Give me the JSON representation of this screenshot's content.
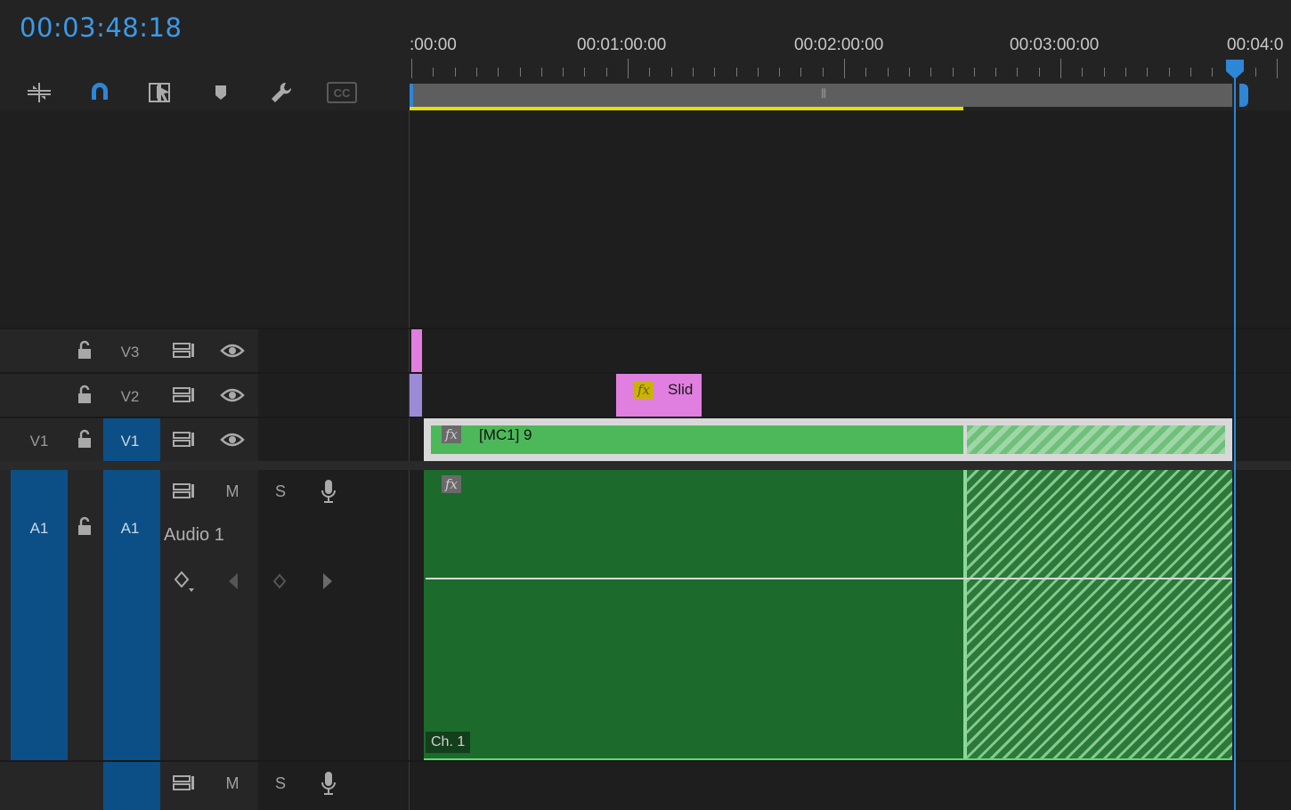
{
  "timecode": "00:03:48:18",
  "ruler": {
    "labels": [
      ":00:00",
      "00:01:00:00",
      "00:02:00:00",
      "00:03:00:00",
      "00:04:0"
    ]
  },
  "tools": [
    {
      "icon": "insert-edit-icon"
    },
    {
      "icon": "snap-magnet-icon"
    },
    {
      "icon": "linked-selection-icon"
    },
    {
      "icon": "add-marker-icon"
    },
    {
      "icon": "settings-wrench-icon"
    },
    {
      "icon": "closed-captions-icon",
      "label": "CC"
    }
  ],
  "tracks": {
    "v3": {
      "label": "V3"
    },
    "v2": {
      "label": "V2"
    },
    "v1": {
      "source": "V1",
      "label": "V1"
    },
    "a1": {
      "source": "A1",
      "label": "A1",
      "name": "Audio 1",
      "mute": "M",
      "solo": "S"
    },
    "a2": {
      "mute": "M",
      "solo": "S"
    }
  },
  "clips": {
    "v2": {
      "fx": "fx",
      "title": "Slid"
    },
    "v1": {
      "fx": "fx",
      "title": "[MC1] 9"
    },
    "a1": {
      "fx": "fx",
      "channel": "Ch. 1"
    }
  },
  "colors": {
    "accent": "#3b9ae8",
    "video_clip": "#4db85a",
    "audio_clip": "#1c6a2c",
    "adjust_clip": "#e07fe0",
    "yellow_bar": "#e8e000"
  }
}
